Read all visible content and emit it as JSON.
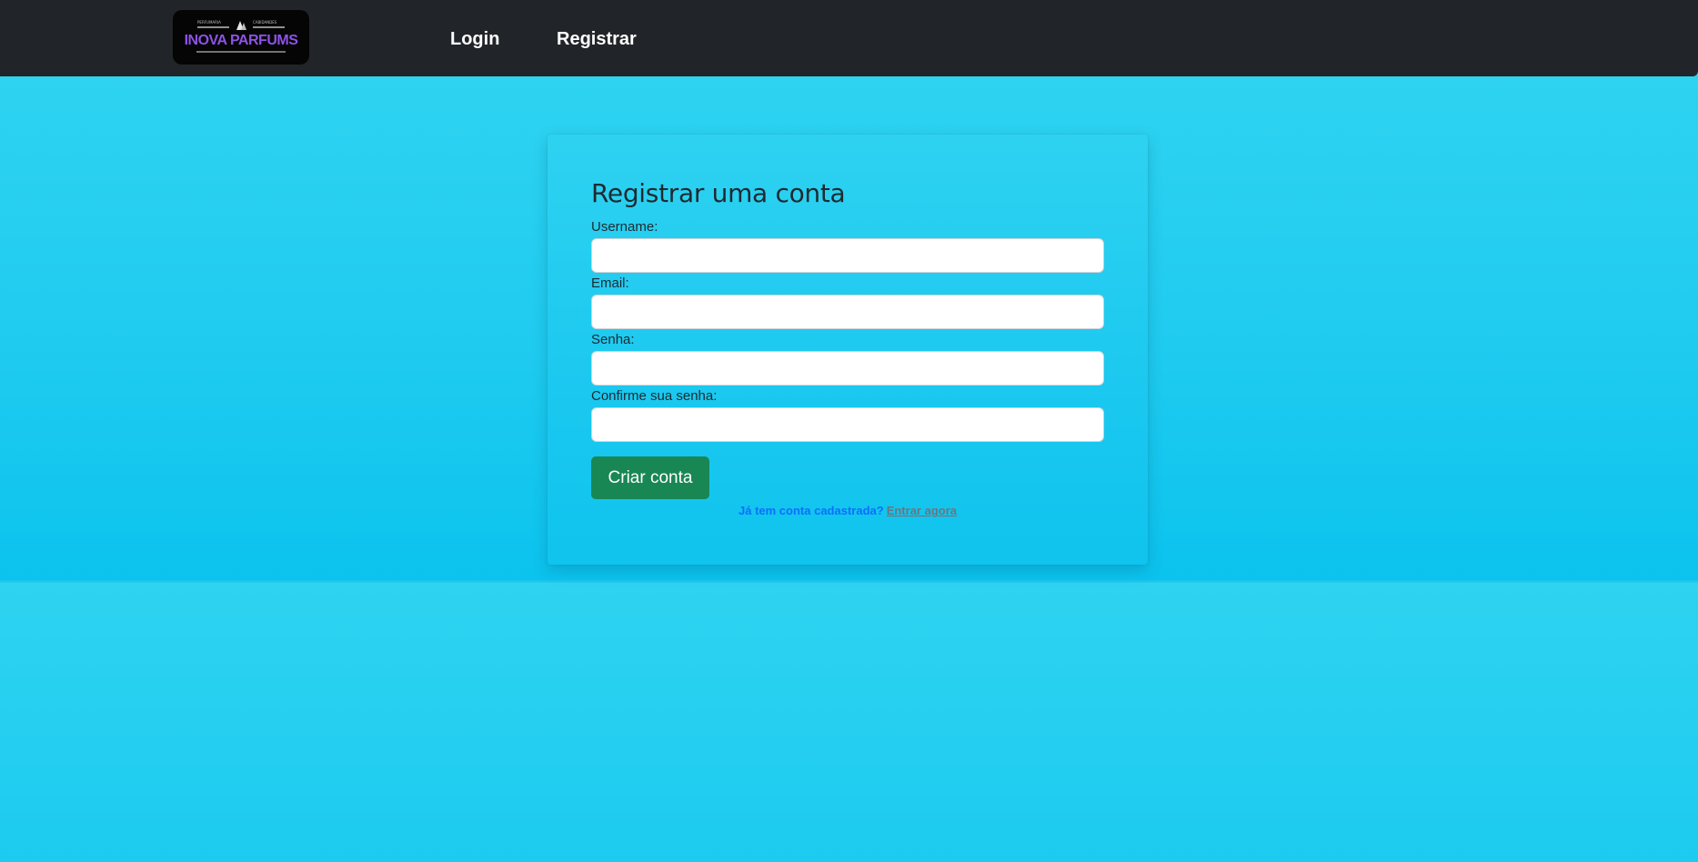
{
  "brand": {
    "name": "INOVA PARFUMS",
    "tagline_left": "PERFUMARIA",
    "tagline_right": "CABIDANDES",
    "colors": {
      "text": "#8e52e8",
      "background": "#050505"
    }
  },
  "nav": {
    "items": [
      {
        "label": "Login"
      },
      {
        "label": "Registrar"
      }
    ]
  },
  "form": {
    "title": "Registrar uma conta",
    "fields": {
      "username": {
        "label": "Username:",
        "value": "",
        "placeholder": ""
      },
      "email": {
        "label": "Email:",
        "value": "",
        "placeholder": ""
      },
      "password": {
        "label": "Senha:",
        "value": "",
        "placeholder": ""
      },
      "confirm": {
        "label": "Confirme sua senha:",
        "value": "",
        "placeholder": ""
      }
    },
    "submit_label": "Criar conta",
    "login_prompt": {
      "text": "Já tem conta cadastrada?",
      "link": "Entrar agora"
    }
  },
  "colors": {
    "navbar": "#212529",
    "page_background": "#22ccef",
    "button_success": "#198754",
    "prompt_text": "#0d6efd",
    "prompt_link": "#6c757d"
  }
}
